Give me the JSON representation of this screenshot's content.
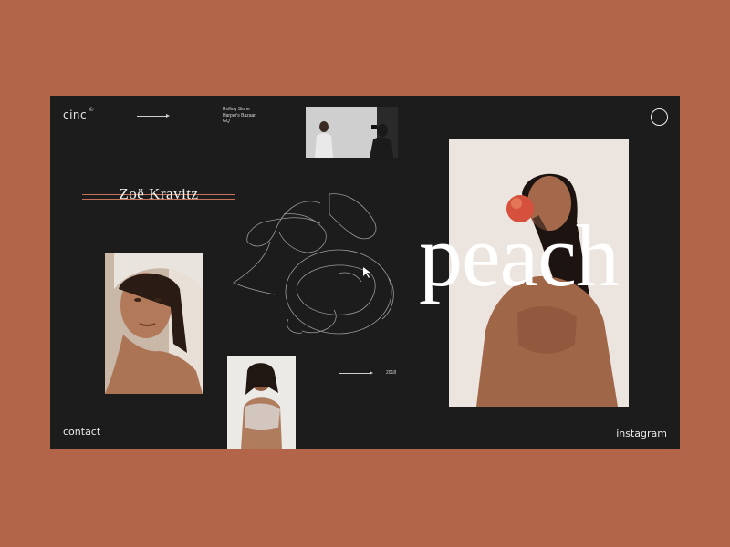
{
  "brand": {
    "name": "cinc",
    "mark": "©"
  },
  "press": [
    "Rolling Stone",
    "Harper's Bazaar",
    "GQ"
  ],
  "hero": {
    "name": "Zoë Kravitz",
    "word": "peach"
  },
  "meta": {
    "year": "2018"
  },
  "nav": {
    "contact": "contact",
    "instagram": "instagram"
  },
  "colors": {
    "page_bg": "#b3654a",
    "panel_bg": "#1c1c1c",
    "accent_line": "#c9745a",
    "text": "#ffffff"
  },
  "icons": [
    "right-arrow-icon",
    "circle-menu-icon",
    "peach-sketch-icon",
    "cursor-icon"
  ]
}
